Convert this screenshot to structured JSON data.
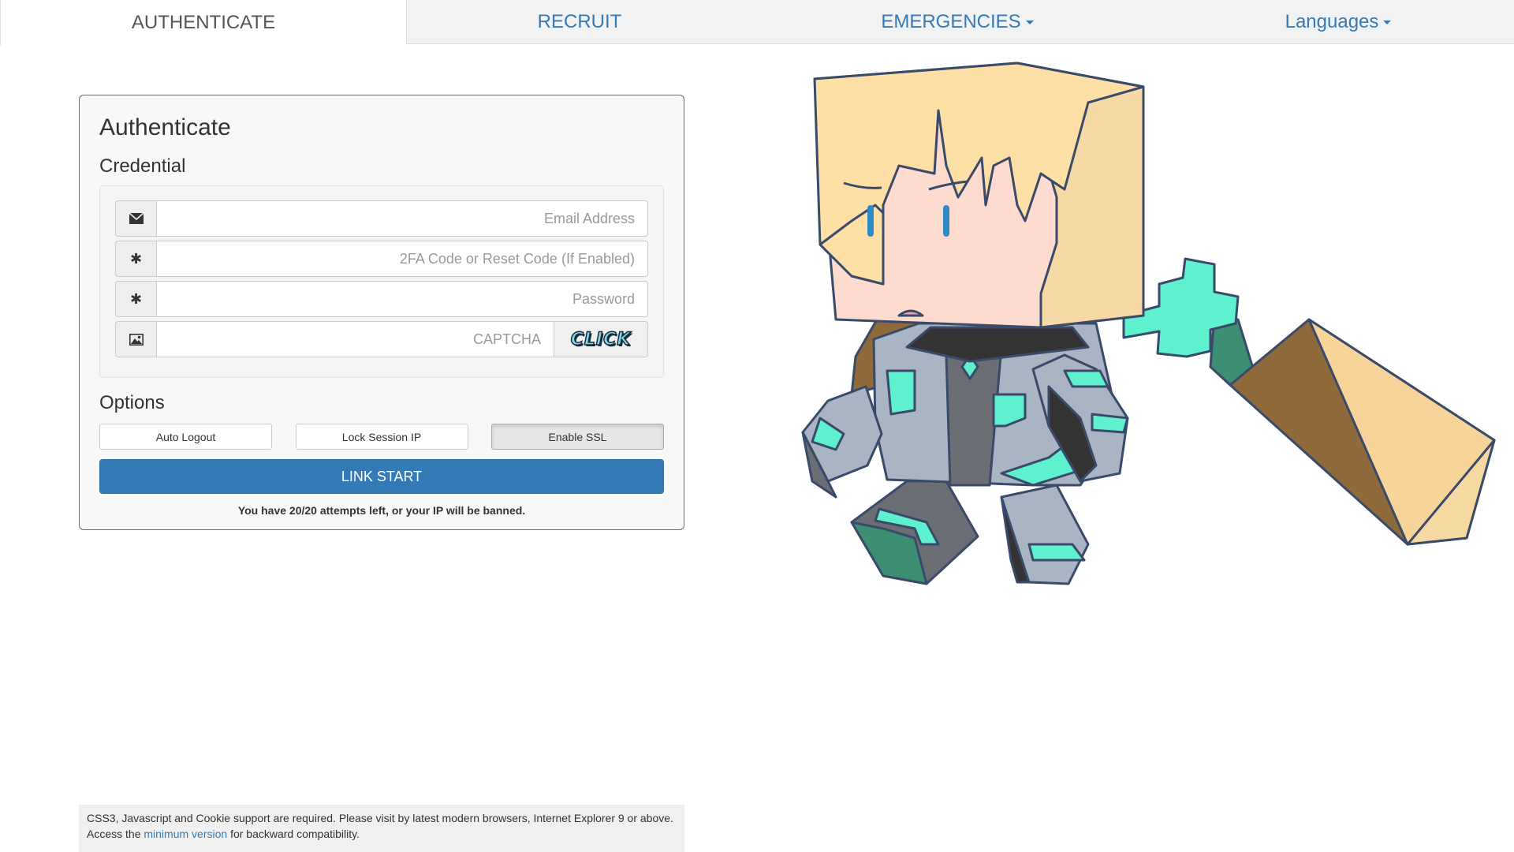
{
  "nav": {
    "tabs": [
      {
        "label": "AUTHENTICATE",
        "active": true
      },
      {
        "label": "RECRUIT",
        "active": false
      },
      {
        "label": "EMERGENCIES",
        "dropdown": true
      },
      {
        "label": "Languages",
        "dropdown": true
      }
    ]
  },
  "auth": {
    "title": "Authenticate",
    "credential_heading": "Credential",
    "fields": {
      "email": {
        "placeholder": "Email Address",
        "icon": "envelope-icon"
      },
      "twofa": {
        "placeholder": "2FA Code or Reset Code (If Enabled)",
        "icon": "asterisk-icon"
      },
      "password": {
        "placeholder": "Password",
        "icon": "asterisk-icon"
      },
      "captcha": {
        "placeholder": "CAPTCHA",
        "icon": "picture-icon",
        "button_text": "CLICK"
      }
    },
    "options_heading": "Options",
    "options": [
      {
        "label": "Auto Logout",
        "active": false
      },
      {
        "label": "Lock Session IP",
        "active": false
      },
      {
        "label": "Enable SSL",
        "active": true
      }
    ],
    "submit_label": "LINK START",
    "attempts_text": "You have 20/20 attempts left, or your IP will be banned."
  },
  "footer": {
    "text_before": "CSS3, Javascript and Cookie support are required. Please visit by latest modern browsers, Internet Explorer 9 or above. Access the ",
    "link_text": "minimum version",
    "text_after": " for backward compatibility."
  },
  "colors": {
    "accent": "#337ab7",
    "nav_bg": "#f2f2f2",
    "panel_bg": "#f7f8f8"
  }
}
